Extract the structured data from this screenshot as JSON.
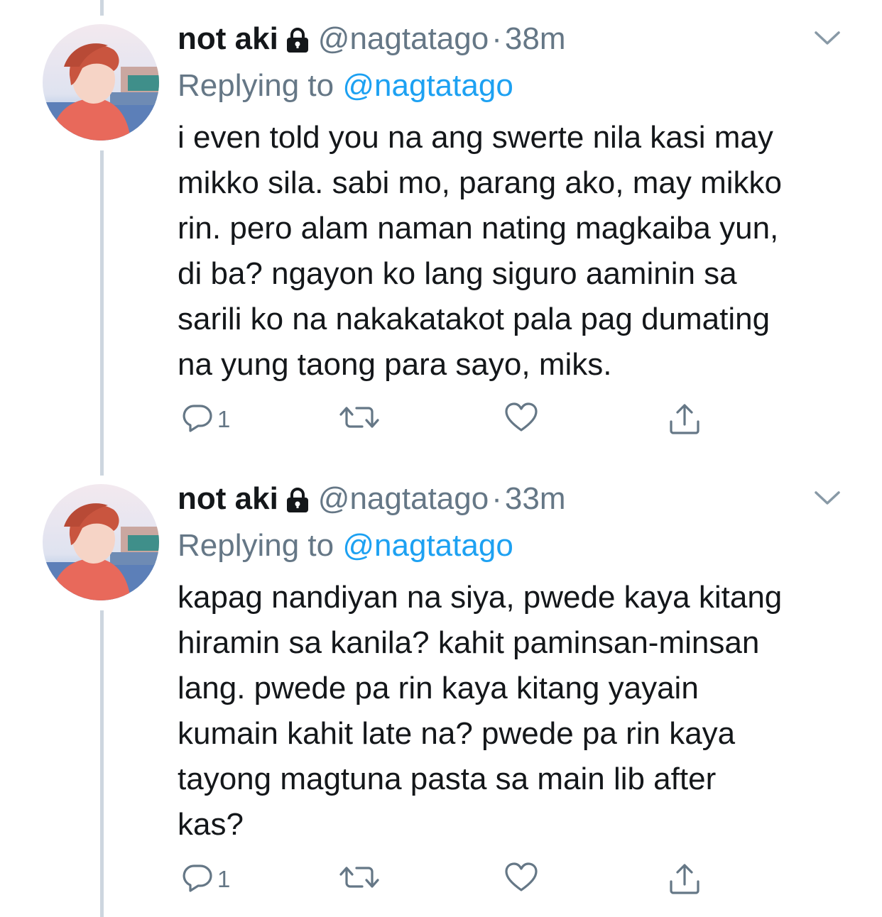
{
  "tweets": [
    {
      "display_name": "not aki",
      "handle": "@nagtatago",
      "separator": "·",
      "time": "38m",
      "replying_prefix": "Replying to",
      "replying_to": "@nagtatago",
      "text": "i even told you na ang swerte nila kasi may\nmikko sila. sabi mo, parang ako, may mikko\nrin. pero alam naman nating magkaiba yun,\ndi ba? ngayon ko lang siguro aaminin sa\nsarili ko na nakakatakot pala pag dumating\nna yung taong para sayo, miks.",
      "reply_count": "1",
      "icons": {
        "reply": "reply-icon",
        "retweet": "retweet-icon",
        "like": "heart-icon",
        "share": "share-icon",
        "lock": "lock-icon",
        "menu": "chevron-down-icon"
      }
    },
    {
      "display_name": "not aki",
      "handle": "@nagtatago",
      "separator": "·",
      "time": "33m",
      "replying_prefix": "Replying to",
      "replying_to": "@nagtatago",
      "text": "kapag nandiyan na siya, pwede kaya kitang\nhiramin sa kanila? kahit paminsan-minsan\nlang. pwede pa rin kaya kitang yayain\nkumain kahit late na? pwede pa rin kaya\ntayong magtuna pasta sa main lib after\nkas?",
      "reply_count": "1",
      "icons": {
        "reply": "reply-icon",
        "retweet": "retweet-icon",
        "like": "heart-icon",
        "share": "share-icon",
        "lock": "lock-icon",
        "menu": "chevron-down-icon"
      }
    }
  ],
  "colors": {
    "text": "#14171a",
    "muted": "#657786",
    "link": "#1da1f2",
    "thread": "#cdd6df"
  }
}
